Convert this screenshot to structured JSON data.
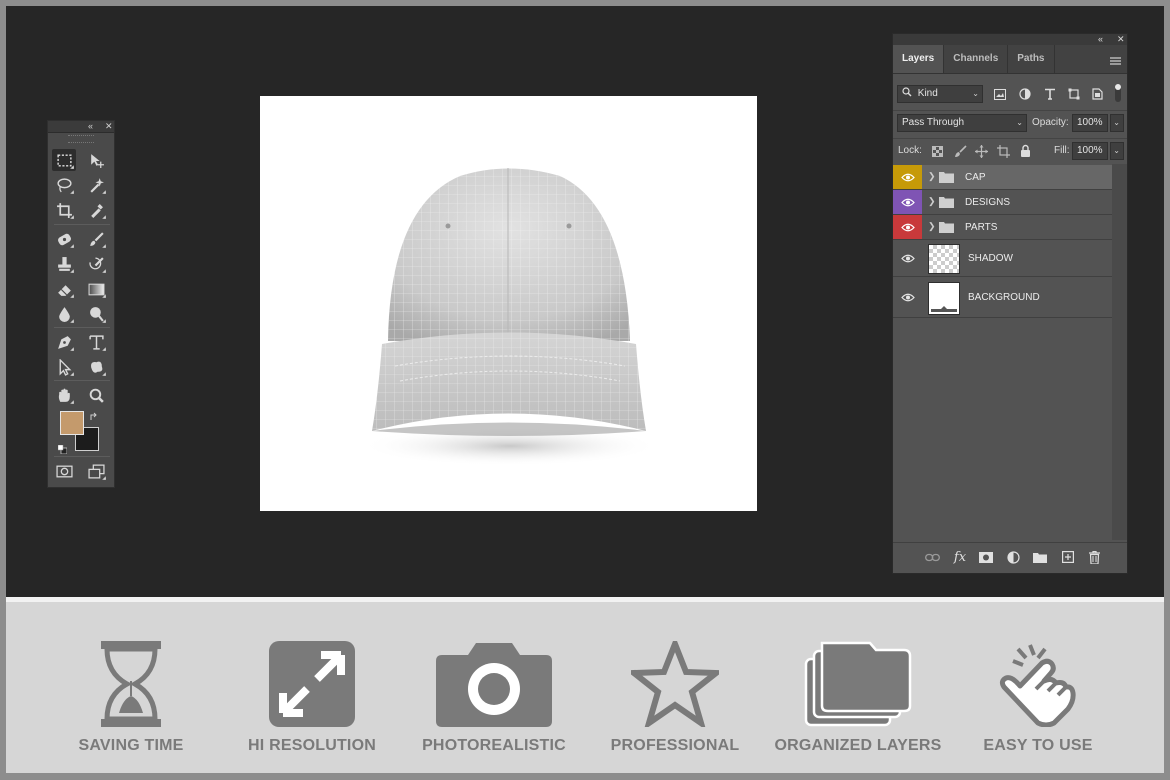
{
  "layers_panel": {
    "tabs": [
      "Layers",
      "Channels",
      "Paths"
    ],
    "filter": "Kind",
    "blend_mode": "Pass Through",
    "opacity_label": "Opacity:",
    "opacity": "100%",
    "lock_label": "Lock:",
    "fill_label": "Fill:",
    "fill": "100%",
    "layers": [
      {
        "name": "CAP",
        "type": "group",
        "color": "#c69a08"
      },
      {
        "name": "DESIGNS",
        "type": "group",
        "color": "#7f54b4"
      },
      {
        "name": "PARTS",
        "type": "group",
        "color": "#c8393b"
      },
      {
        "name": "SHADOW",
        "type": "layer",
        "thumb": "transparent"
      },
      {
        "name": "BACKGROUND",
        "type": "layer",
        "thumb": "white"
      }
    ]
  },
  "toolbox": {
    "foreground_color": "#c49a6c",
    "background_color": "#1c1c1c"
  },
  "features": [
    {
      "label": "SAVING TIME",
      "icon": "hourglass-icon"
    },
    {
      "label": "HI RESOLUTION",
      "icon": "expand-arrows-icon"
    },
    {
      "label": "PHOTOREALISTIC",
      "icon": "camera-icon"
    },
    {
      "label": "PROFESSIONAL",
      "icon": "star-icon"
    },
    {
      "label": "ORGANIZED LAYERS",
      "icon": "layers-folder-icon"
    },
    {
      "label": "EASY TO USE",
      "icon": "tap-hand-icon"
    }
  ],
  "colors": {
    "workspace": "#262626",
    "panel": "#535353",
    "feature_bar": "#d6d6d6",
    "feature_icon": "#7a7a7a"
  }
}
